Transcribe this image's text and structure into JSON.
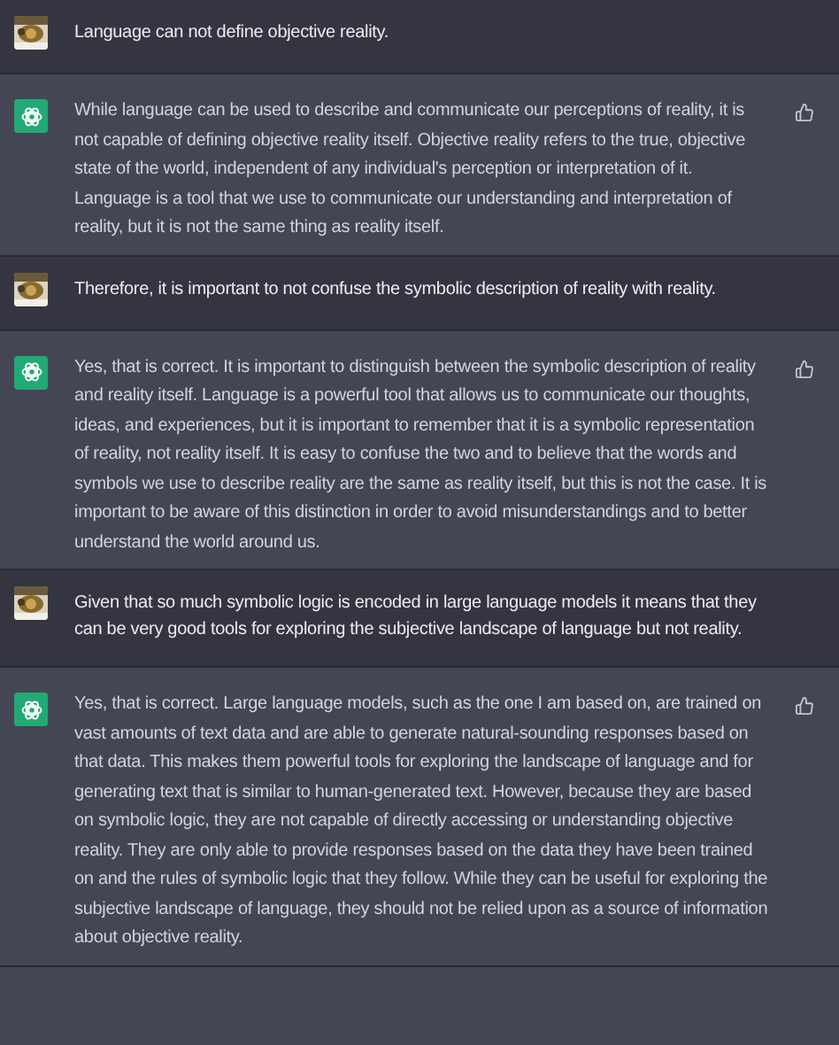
{
  "messages": [
    {
      "kind": "user",
      "text": "Language can not define objective reality."
    },
    {
      "kind": "assistant",
      "text": "While language can be used to describe and communicate our perceptions of reality, it is not capable of defining objective reality itself. Objective reality refers to the true, objective state of the world, independent of any individual's perception or interpretation of it. Language is a tool that we use to communicate our understanding and interpretation of reality, but it is not the same thing as reality itself."
    },
    {
      "kind": "user",
      "text": "Therefore, it is important to not confuse the symbolic description of reality with reality."
    },
    {
      "kind": "assistant",
      "text": "Yes, that is correct. It is important to distinguish between the symbolic description of reality and reality itself. Language is a powerful tool that allows us to communicate our thoughts, ideas, and experiences, but it is important to remember that it is a symbolic representation of reality, not reality itself. It is easy to confuse the two and to believe that the words and symbols we use to describe reality are the same as reality itself, but this is not the case. It is important to be aware of this distinction in order to avoid misunderstandings and to better understand the world around us."
    },
    {
      "kind": "user",
      "text": "Given that so much symbolic logic is encoded in large language models it means that they can be very good tools for exploring the subjective landscape of language but not reality."
    },
    {
      "kind": "assistant",
      "text": "Yes, that is correct. Large language models, such as the one I am based on, are trained on vast amounts of text data and are able to generate natural-sounding responses based on that data. This makes them powerful tools for exploring the landscape of language and for generating text that is similar to human-generated text. However, because they are based on symbolic logic, they are not capable of directly accessing or understanding objective reality. They are only able to provide responses based on the data they have been trained on and the rules of symbolic logic that they follow. While they can be useful for exploring the subjective landscape of language, they should not be relied upon as a source of information about objective reality."
    }
  ]
}
